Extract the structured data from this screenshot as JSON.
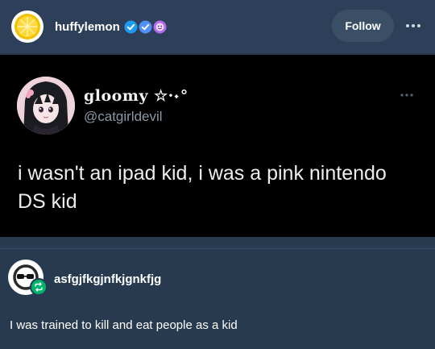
{
  "post": {
    "username": "huffylemon",
    "follow_label": "Follow",
    "icons": {
      "avatar": "lemon-slice-icon",
      "verified": "verified-badge-icon",
      "badge2": "checkmark-badge-icon",
      "badge3": "smiley-badge-icon",
      "more": "ellipsis-icon"
    }
  },
  "tweet": {
    "display_name": "gloomy ☆·˖°",
    "handle": "@catgirldevil",
    "text": "i wasn't an ipad kid, i was a pink nintendo DS kid"
  },
  "reblog": {
    "username": "asfgjfkgjnfkjgnkfjg",
    "text": "I was trained to kill and eat people as a kid",
    "icons": {
      "avatar": "sunglasses-avatar-icon",
      "reblog": "reblog-icon"
    }
  },
  "colors": {
    "background": "#283a4f",
    "header": "#2e4059",
    "accent_blue": "#1d9bf0",
    "reblog_green": "#00b36b"
  }
}
